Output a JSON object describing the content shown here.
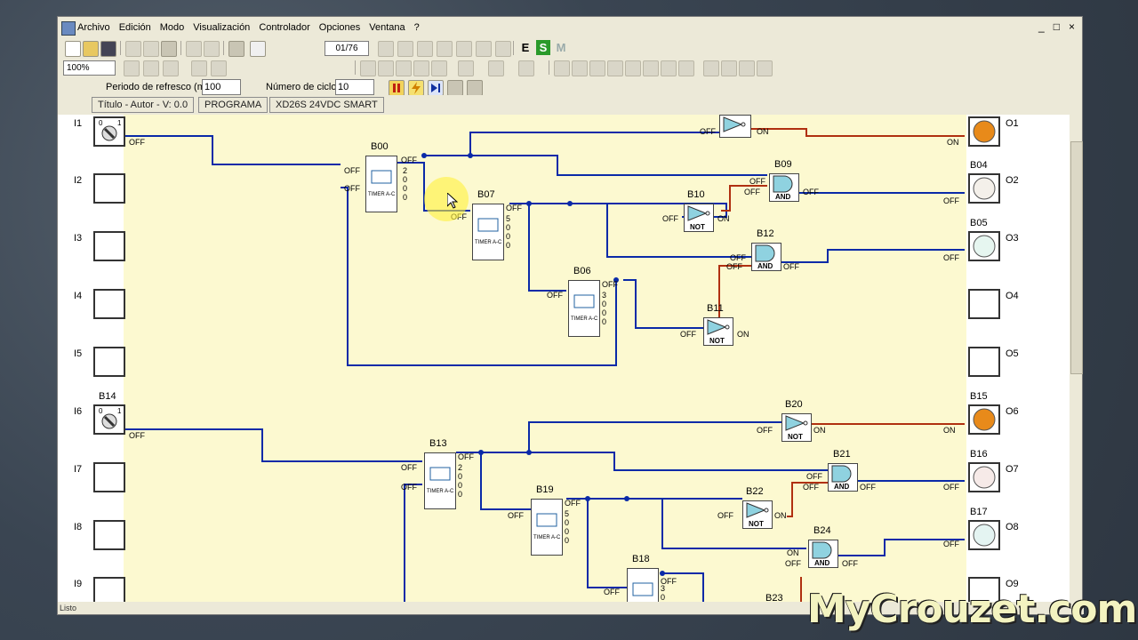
{
  "menu": {
    "items": [
      "Archivo",
      "Edición",
      "Modo",
      "Visualización",
      "Controlador",
      "Opciones",
      "Ventana",
      "?"
    ]
  },
  "window_controls": [
    "_",
    "□",
    "×"
  ],
  "toolbar1": {
    "counter": "01/76",
    "mode_letters": [
      "E",
      "S",
      "M"
    ]
  },
  "toolbar2": {
    "zoom": "100%"
  },
  "params": {
    "refresh_label": "Periodo de refresco (ms)",
    "refresh_value": "100",
    "cycles_label": "Número de ciclos",
    "cycles_value": "10"
  },
  "infobar": {
    "title": "Título - Autor - V: 0.0",
    "program": "PROGRAMA",
    "model": "XD26S 24VDC SMART"
  },
  "inputs": [
    "I1",
    "I2",
    "I3",
    "I4",
    "I5",
    "I6",
    "I7",
    "I8",
    "I9"
  ],
  "input_names": [
    "B14"
  ],
  "outputs": [
    "O1",
    "O2",
    "O3",
    "O4",
    "O5",
    "O6",
    "O7",
    "O8",
    "O9"
  ],
  "output_names": [
    "B04",
    "B05",
    "B15",
    "B16",
    "B17"
  ],
  "blocks": {
    "timers": [
      {
        "id": "B00",
        "params": [
          "2",
          "0",
          "0",
          "0"
        ]
      },
      {
        "id": "B07",
        "params": [
          "5",
          "0",
          "0",
          "0"
        ]
      },
      {
        "id": "B06",
        "params": [
          "3",
          "0",
          "0",
          "0"
        ]
      },
      {
        "id": "B13",
        "params": [
          "2",
          "0",
          "0",
          "0"
        ]
      },
      {
        "id": "B19",
        "params": [
          "5",
          "0",
          "0",
          "0"
        ]
      },
      {
        "id": "B18",
        "params": [
          "3",
          "0"
        ]
      }
    ],
    "not_gates": [
      "B10",
      "B11",
      "B20",
      "B22"
    ],
    "and_gates": [
      "B09",
      "B12",
      "B21",
      "B24"
    ],
    "partial": [
      "B23"
    ],
    "timer_label": "TIMER A-C",
    "not_label": "NOT",
    "and_label": "AND",
    "and_symbol": "&",
    "not_symbol": "1"
  },
  "states": {
    "off": "OFF",
    "on": "ON"
  },
  "status_text": "Listo",
  "watermark": "MyCrouzet.com",
  "colors": {
    "off_wire": "#0a2aa8",
    "on_wire": "#b03010",
    "lamp_on": "#e88a1a",
    "canvas": "#fcf9d0"
  },
  "icons": [
    "new-file-icon",
    "open-icon",
    "save-icon",
    "cut-icon",
    "copy-icon",
    "paste-icon",
    "undo-icon",
    "redo-icon",
    "print-icon",
    "help-icon",
    "pause-icon",
    "lightning-icon",
    "step-icon",
    "cursor-arrow-icon"
  ]
}
